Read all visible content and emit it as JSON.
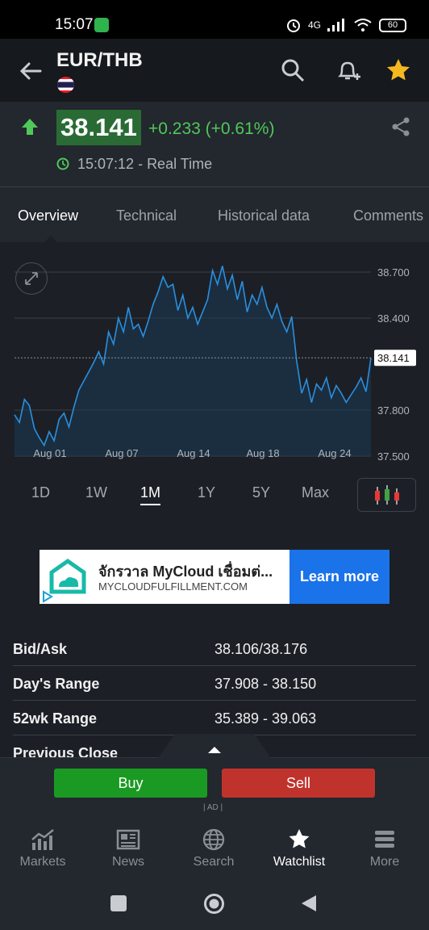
{
  "status_bar": {
    "time": "15:07",
    "battery": "60",
    "network": "4G"
  },
  "header": {
    "title": "EUR/THB"
  },
  "quote": {
    "price": "38.141",
    "change": "+0.233 (+0.61%)",
    "time": "15:07:12 - Real Time"
  },
  "tabs": [
    "Overview",
    "Technical",
    "Historical data",
    "Comments"
  ],
  "range_tabs": [
    "1D",
    "1W",
    "1M",
    "1Y",
    "5Y",
    "Max"
  ],
  "chart_data": {
    "type": "area",
    "x_ticks": [
      "Aug 01",
      "Aug 07",
      "Aug 14",
      "Aug 18",
      "Aug 24"
    ],
    "y_ticks": [
      "38.700",
      "38.400",
      "37.800",
      "37.500"
    ],
    "current_label": "38.141",
    "ylim": [
      37.5,
      38.8
    ],
    "grid": true,
    "values": [
      37.77,
      37.72,
      37.87,
      37.83,
      37.68,
      37.62,
      37.57,
      37.66,
      37.6,
      37.74,
      37.78,
      37.69,
      37.82,
      37.93,
      37.99,
      38.05,
      38.11,
      38.18,
      38.1,
      38.31,
      38.23,
      38.4,
      38.31,
      38.47,
      38.33,
      38.36,
      38.28,
      38.38,
      38.49,
      38.57,
      38.67,
      38.6,
      38.62,
      38.45,
      38.55,
      38.4,
      38.47,
      38.36,
      38.44,
      38.52,
      38.71,
      38.62,
      38.74,
      38.59,
      38.68,
      38.52,
      38.64,
      38.44,
      38.55,
      38.49,
      38.6,
      38.47,
      38.4,
      38.49,
      38.38,
      38.31,
      38.41,
      38.12,
      37.91,
      38.0,
      37.85,
      37.97,
      37.93,
      38.01,
      37.88,
      37.96,
      37.91,
      37.85,
      37.9,
      37.95,
      38.01,
      37.92,
      38.14
    ]
  },
  "ad": {
    "title": "จักรวาล MyCloud เชื่อมต่...",
    "url": "MYCLOUDFULFILLMENT.COM",
    "cta": "Learn more",
    "tag": "| AD |"
  },
  "stats": [
    {
      "label": "Bid/Ask",
      "value": "38.106/38.176"
    },
    {
      "label": "Day's Range",
      "value": "37.908 - 38.150"
    },
    {
      "label": "52wk Range",
      "value": "35.389 - 39.063"
    },
    {
      "label": "Previous Close",
      "value": ""
    }
  ],
  "trade": {
    "buy": "Buy",
    "sell": "Sell"
  },
  "nav": [
    "Markets",
    "News",
    "Search",
    "Watchlist",
    "More"
  ],
  "colors": {
    "up": "#4fc85a",
    "buy": "#1a9a22",
    "sell": "#c0332c",
    "line": "#2a8fe0",
    "star": "#f5b820"
  }
}
